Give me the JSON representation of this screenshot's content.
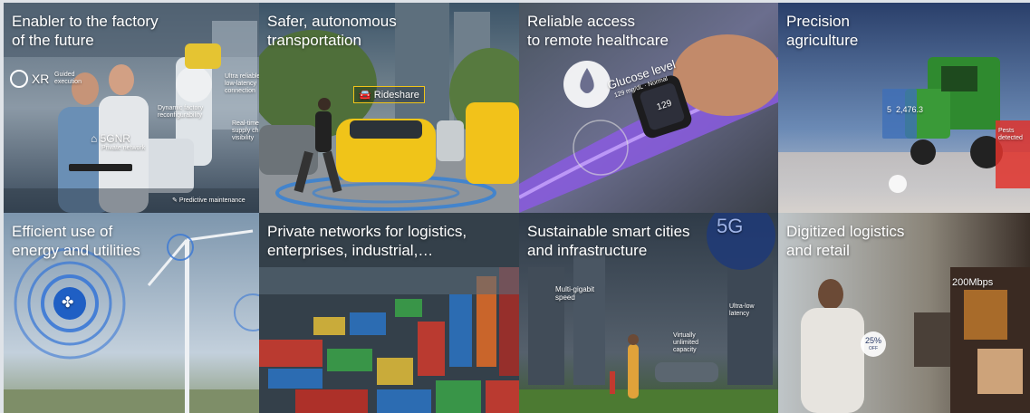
{
  "tiles": [
    {
      "id": "factory",
      "title": [
        "Enabler to the factory",
        "of the future"
      ],
      "labels": {
        "xr": "XR",
        "guided": "Guided\nexecution",
        "ultra": "Ultra reliable\nlow-latency\nconnection",
        "dynamic": "Dynamic factory\nreconfigurability",
        "realtime": "Real-time\nsupply ch\nvisibility",
        "fivegnr": "5GNR",
        "private": "Private network",
        "predictive": "Predictive maintenance"
      }
    },
    {
      "id": "transport",
      "title": [
        "Safer, autonomous",
        "transportation"
      ],
      "labels": {
        "rideshare": "Rideshare"
      }
    },
    {
      "id": "healthcare",
      "title": [
        "Reliable access",
        "to remote healthcare"
      ],
      "labels": {
        "glucose": "Glucose level",
        "reading": "129 mg/dL · Normal",
        "watch": "129"
      }
    },
    {
      "id": "agriculture",
      "title": [
        "Precision",
        "agriculture"
      ],
      "labels": {
        "pests": "Pests\ndetected",
        "stat": "2,476.3",
        "num": "5"
      }
    },
    {
      "id": "energy",
      "title": [
        "Efficient use of",
        "energy and utilities"
      ],
      "labels": {}
    },
    {
      "id": "logistics",
      "title": [
        "Private networks for logistics,",
        "enterprises, industrial,…"
      ],
      "labels": {}
    },
    {
      "id": "cities",
      "title": [
        "Sustainable smart cities",
        "and infrastructure"
      ],
      "labels": {
        "fiveg": "5G",
        "multigig": "Multi-gigabit\nspeed",
        "ultralow": "Ultra-low\nlatency",
        "virtually": "Virtually\nunlimited\ncapacity"
      }
    },
    {
      "id": "retail",
      "title": [
        "Digitized logistics",
        "and retail"
      ],
      "labels": {
        "mbps": "200Mbps",
        "discount": "25%",
        "off": "OFF"
      }
    }
  ]
}
